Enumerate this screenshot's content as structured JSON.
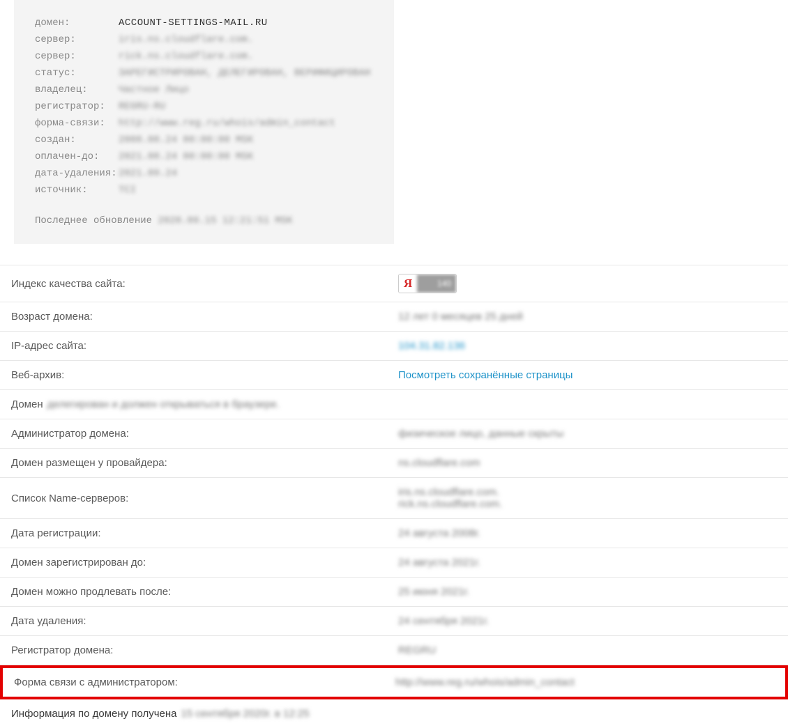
{
  "whois": {
    "labels": {
      "domain": "домен:",
      "server1": "сервер:",
      "server2": "сервер:",
      "status": "статус:",
      "owner": "владелец:",
      "registrar": "регистратор:",
      "contact_form": "форма-связи:",
      "created": "создан:",
      "paid_till": "оплачен-до:",
      "delete_date": "дата-удаления:",
      "source": "источник:"
    },
    "values": {
      "domain": "ACCOUNT-SETTINGS-MAIL.RU",
      "server1": "iris.ns.cloudflare.com.",
      "server2": "rick.ns.cloudflare.com.",
      "status": "ЗАРЕГИСТРИРОВАН, ДЕЛЕГИРОВАН, ВЕРИФИЦИРОВАН",
      "owner": "Частное Лицо",
      "registrar": "REGRU-RU",
      "contact_form": "http://www.reg.ru/whois/admin_contact",
      "created": "2008.08.24 00:00:00 MSK",
      "paid_till": "2021.08.24 00:00:00 MSK",
      "delete_date": "2021.09.24",
      "source": "TCI"
    },
    "footer_label": "Последнее обновление",
    "footer_value": "2020.09.15 12:21:51 MSK"
  },
  "info": {
    "quality_index_label": "Индекс качества сайта:",
    "ya_letter": "Я",
    "ya_value": "140",
    "domain_age_label": "Возраст домена:",
    "domain_age_value": "12 лет 0 месяцев 25 дней",
    "ip_label": "IP-адрес сайта:",
    "ip_value": "104.31.82.136",
    "webarchive_label": "Веб-архив:",
    "webarchive_link": "Посмотреть сохранённые страницы",
    "domain_delegated_label": "Домен",
    "domain_delegated_value": "делегирован и должен открываться в браузере.",
    "admin_label": "Администратор домена:",
    "admin_value": "физическое лицо, данные скрыты",
    "provider_label": "Домен размещен у провайдера:",
    "provider_value": "ns.cloudflare.com",
    "ns_label": "Список Name-серверов:",
    "ns_value1": "iris.ns.cloudflare.com.",
    "ns_value2": "rick.ns.cloudflare.com.",
    "reg_date_label": "Дата регистрации:",
    "reg_date_value": "24 августа 2008г.",
    "reg_until_label": "Домен зарегистрирован до:",
    "reg_until_value": "24 августа 2021г.",
    "renew_after_label": "Домен можно продлевать после:",
    "renew_after_value": "25 июня 2021г.",
    "delete_date_label": "Дата удаления:",
    "delete_date_value": "24 сентября 2021г.",
    "registrar_label": "Регистратор домена:",
    "registrar_value": "REGRU",
    "contact_form_label": "Форма связи с администратором:",
    "contact_form_value": "http://www.reg.ru/whois/admin_contact",
    "received_label": "Информация по домену получена",
    "received_value": "15 сентября 2020г. в 12:25"
  }
}
